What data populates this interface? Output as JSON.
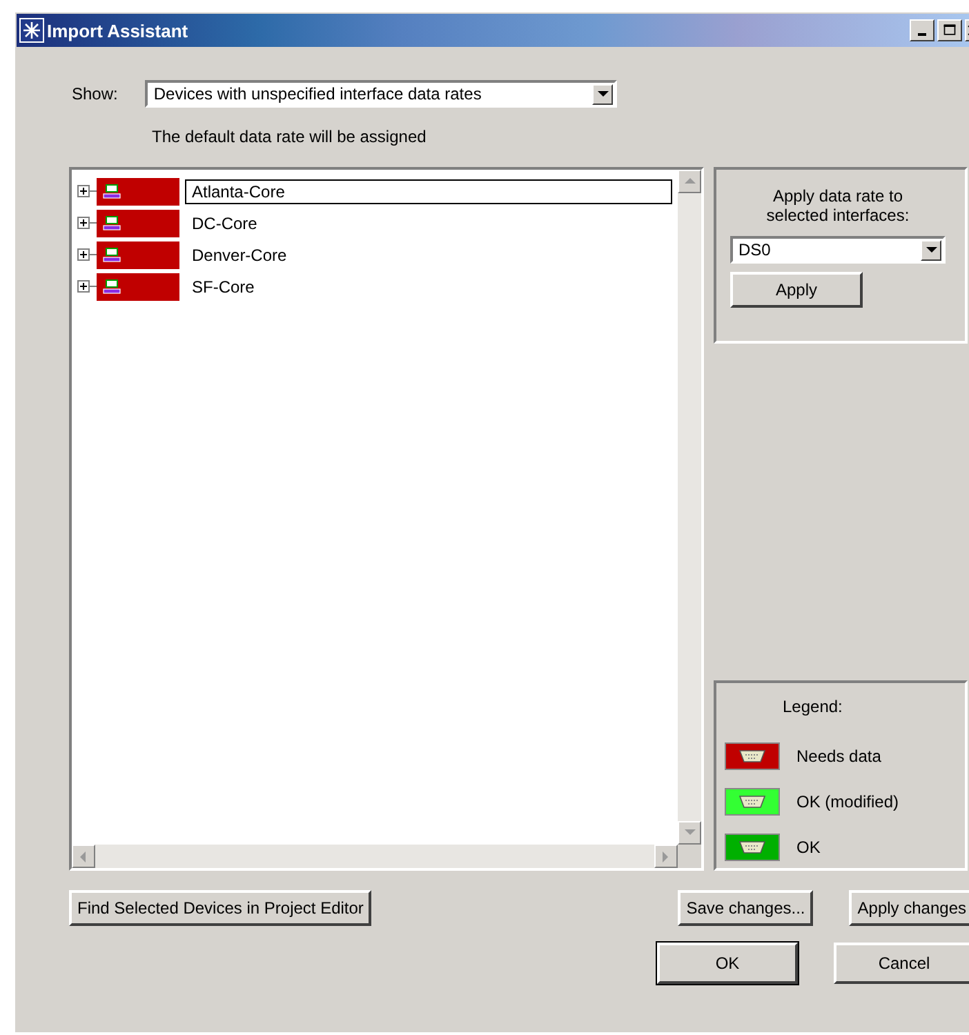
{
  "window": {
    "title": "Import Assistant"
  },
  "show": {
    "label": "Show:",
    "value": "Devices with unspecified interface data rates"
  },
  "hint": "The default data rate will be assigned",
  "devices": [
    {
      "label": "Atlanta-Core",
      "expanded": false,
      "selected": true,
      "color": "#c00000"
    },
    {
      "label": "DC-Core",
      "expanded": false,
      "selected": false,
      "color": "#c00000"
    },
    {
      "label": "Denver-Core",
      "expanded": false,
      "selected": false,
      "color": "#c00000"
    },
    {
      "label": "SF-Core",
      "expanded": false,
      "selected": false,
      "color": "#c00000"
    }
  ],
  "rate_panel": {
    "label": "Apply data rate to selected interfaces:",
    "value": "DS0",
    "button": "Apply"
  },
  "legend": {
    "title": "Legend:",
    "items": [
      {
        "label": "Needs data",
        "color": "#c00000"
      },
      {
        "label": "OK (modified)",
        "color": "#33ff33"
      },
      {
        "label": "OK",
        "color": "#00b000"
      }
    ]
  },
  "buttons": [
    "Find Selected Devices in Project Editor",
    "Save changes...",
    "Apply changes"
  ],
  "dialog_buttons": [
    {
      "label": "OK",
      "default": true
    },
    {
      "label": "Cancel",
      "default": false
    }
  ]
}
